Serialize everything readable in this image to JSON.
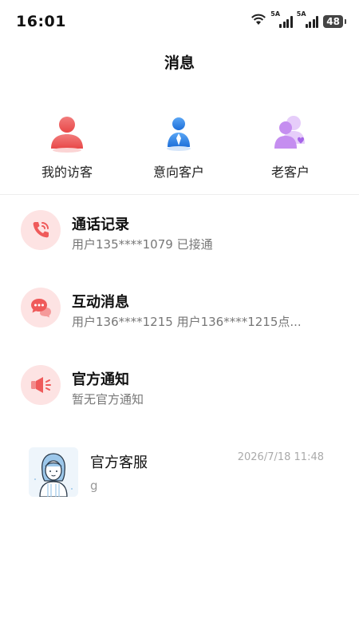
{
  "status": {
    "time": "16:01",
    "signal1_label": "5A",
    "signal2_label": "5A",
    "battery": "48"
  },
  "header": {
    "title": "消息"
  },
  "quick_actions": [
    {
      "label": "我的访客",
      "icon": "visitor-person-icon",
      "color": "#ef5a5a"
    },
    {
      "label": "意向客户",
      "icon": "intent-customer-icon",
      "color": "#2f86e8"
    },
    {
      "label": "老客户",
      "icon": "old-customer-icon",
      "color": "#c58ef0"
    }
  ],
  "messages": [
    {
      "title": "通话记录",
      "subtitle": "用户135****1079 已接通",
      "icon": "phone-icon"
    },
    {
      "title": "互动消息",
      "subtitle": "用户136****1215 用户136****1215点...",
      "icon": "chat-bubbles-icon"
    },
    {
      "title": "官方通知",
      "subtitle": "暂无官方通知",
      "icon": "megaphone-icon"
    }
  ],
  "service": {
    "name": "官方客服",
    "time": "2026/7/18 11:48",
    "last_message": "g"
  },
  "colors": {
    "accent_red": "#ef5a5a",
    "icon_circle_bg": "#fde3e3",
    "blue": "#2f86e8",
    "purple": "#c58ef0"
  }
}
